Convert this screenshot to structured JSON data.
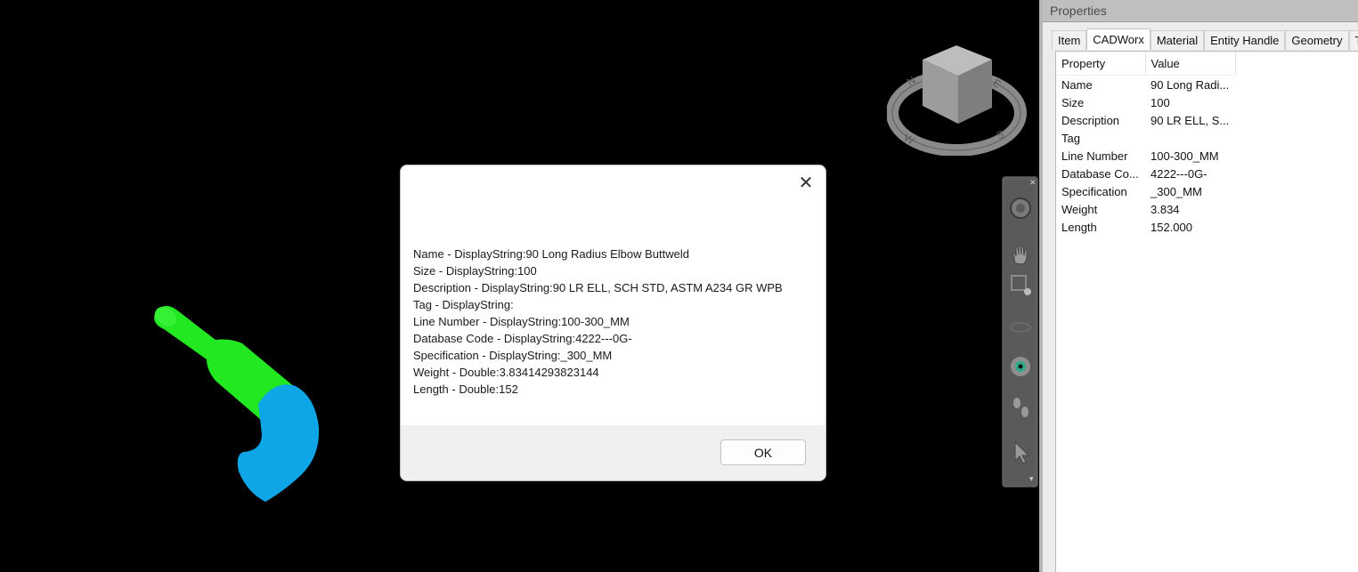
{
  "dialog": {
    "lines": [
      "Name - DisplayString:90 Long Radius Elbow Buttweld",
      "Size - DisplayString:100",
      "Description - DisplayString:90 LR ELL, SCH STD, ASTM A234 GR WPB",
      "Tag - DisplayString:",
      "Line Number - DisplayString:100-300_MM",
      "Database Code - DisplayString:4222---0G-",
      "Specification - DisplayString:_300_MM",
      "Weight - Double:3.83414293823144",
      "Length - Double:152"
    ],
    "ok_label": "OK",
    "close_glyph": "✕"
  },
  "properties": {
    "title": "Properties",
    "tabs": [
      "Item",
      "CADWorx",
      "Material",
      "Entity Handle",
      "Geometry",
      "Ti"
    ],
    "active_tab": "CADWorx",
    "header": {
      "property": "Property",
      "value": "Value"
    },
    "rows": [
      {
        "property": "Name",
        "value": "90 Long Radi..."
      },
      {
        "property": "Size",
        "value": "100"
      },
      {
        "property": "Description",
        "value": "90 LR ELL, S..."
      },
      {
        "property": "Tag",
        "value": ""
      },
      {
        "property": "Line Number",
        "value": "100-300_MM"
      },
      {
        "property": "Database Co...",
        "value": "4222---0G-"
      },
      {
        "property": "Specification",
        "value": "_300_MM"
      },
      {
        "property": "Weight",
        "value": "3.834"
      },
      {
        "property": "Length",
        "value": "152.000"
      }
    ]
  },
  "viewcube": {
    "labels": [
      "N",
      "E",
      "S",
      "W"
    ]
  },
  "colors": {
    "pipe": "#22e822",
    "elbow": "#0ea6e6",
    "viewport_bg": "#000000"
  }
}
